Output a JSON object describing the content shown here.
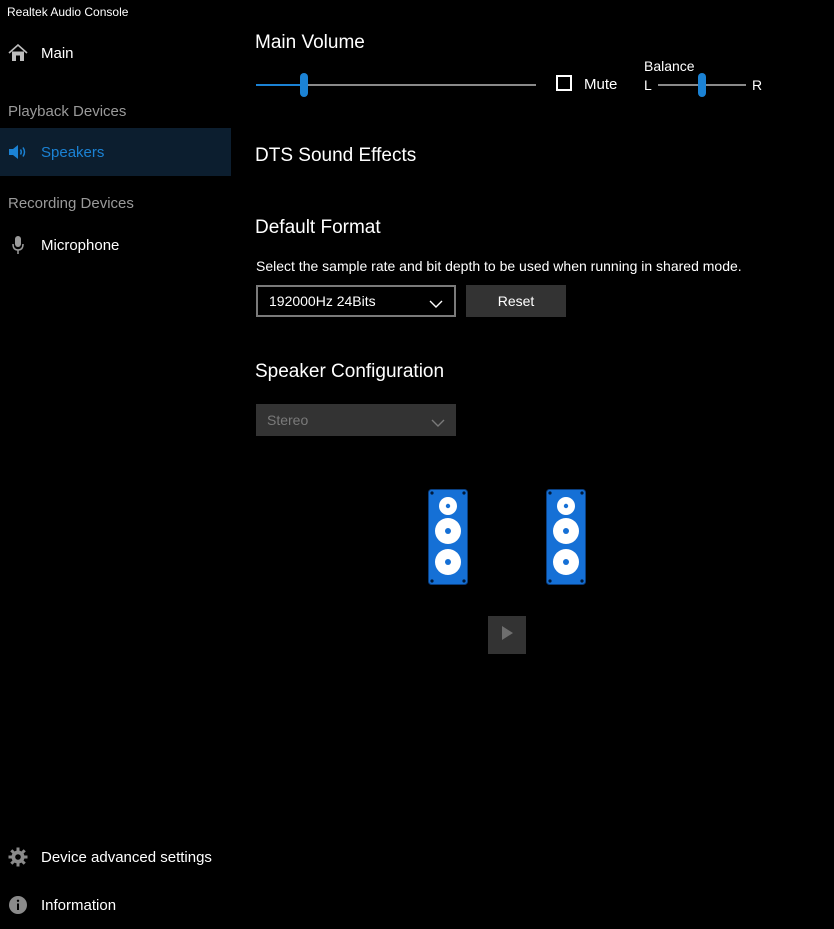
{
  "app": {
    "title": "Realtek Audio Console"
  },
  "sidebar": {
    "main_label": "Main",
    "playback_header": "Playback Devices",
    "speakers_label": "Speakers",
    "recording_header": "Recording Devices",
    "microphone_label": "Microphone",
    "advanced_label": "Device advanced settings",
    "information_label": "Information"
  },
  "main_volume": {
    "title": "Main Volume",
    "level": 0.17,
    "mute_label": "Mute",
    "mute_checked": false
  },
  "balance": {
    "title": "Balance",
    "left_label": "L",
    "right_label": "R",
    "position": 0.5
  },
  "dts": {
    "title": "DTS Sound Effects"
  },
  "default_format": {
    "title": "Default Format",
    "description": "Select the sample rate and bit depth to be used when running in shared mode.",
    "selected": "192000Hz 24Bits",
    "reset_label": "Reset"
  },
  "speaker_config": {
    "title": "Speaker Configuration",
    "selected": "Stereo"
  },
  "colors": {
    "accent": "#1b82d4",
    "speaker_blue": "#1570d6",
    "selected_bg": "#0c1e2f"
  }
}
